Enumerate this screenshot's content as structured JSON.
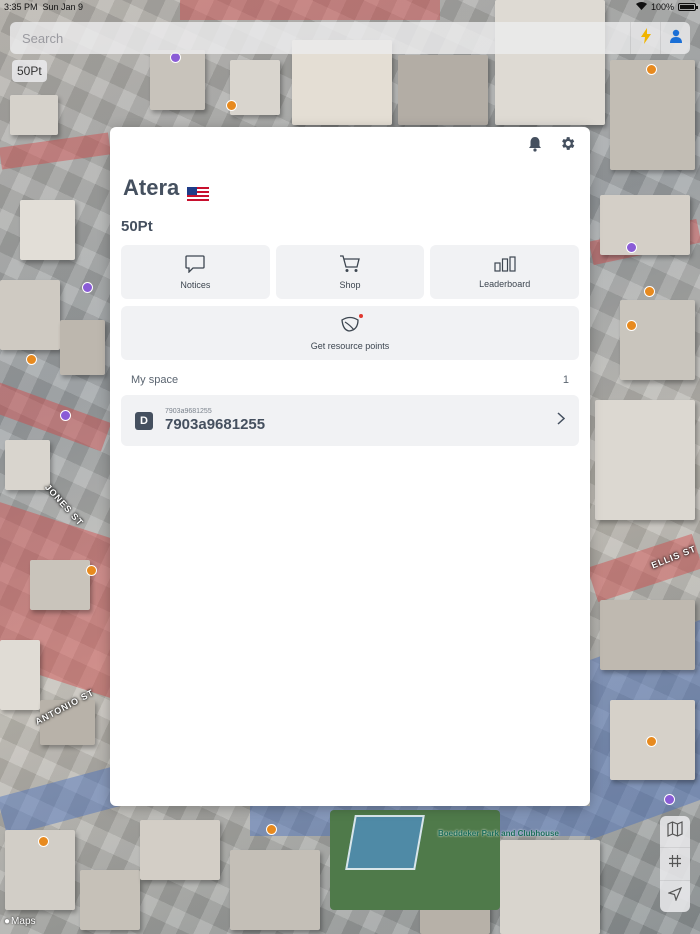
{
  "status_bar": {
    "time": "3:35 PM",
    "date": "Sun Jan 9",
    "battery": "100%",
    "battery_level": 1.0
  },
  "search": {
    "placeholder": "Search"
  },
  "map": {
    "points_chip": "50Pt",
    "street_labels": [
      "JONES ST",
      "ANTONIO ST",
      "ELLIS ST"
    ],
    "park_label": "Boeddeker Park and Clubhouse",
    "attribution": "Maps"
  },
  "panel": {
    "user_name": "Atera",
    "flag_icon": "us-flag-icon",
    "points": "50Pt",
    "tiles": [
      {
        "label": "Notices",
        "icon": "chat-bubble-icon"
      },
      {
        "label": "Shop",
        "icon": "cart-icon"
      },
      {
        "label": "Leaderboard",
        "icon": "bar-chart-icon"
      }
    ],
    "resource": {
      "label": "Get resource points",
      "icon": "leaf-icon"
    },
    "my_space": {
      "title": "My space",
      "count": "1",
      "items": [
        {
          "badge": "D",
          "subtitle": "7903a9681255",
          "title": "7903a9681255"
        }
      ]
    }
  },
  "colors": {
    "accent": "#1a6fd6",
    "bolt": "#f0b400",
    "text": "#45505f",
    "tile": "#f1f2f4",
    "dot": "#e0392f"
  }
}
